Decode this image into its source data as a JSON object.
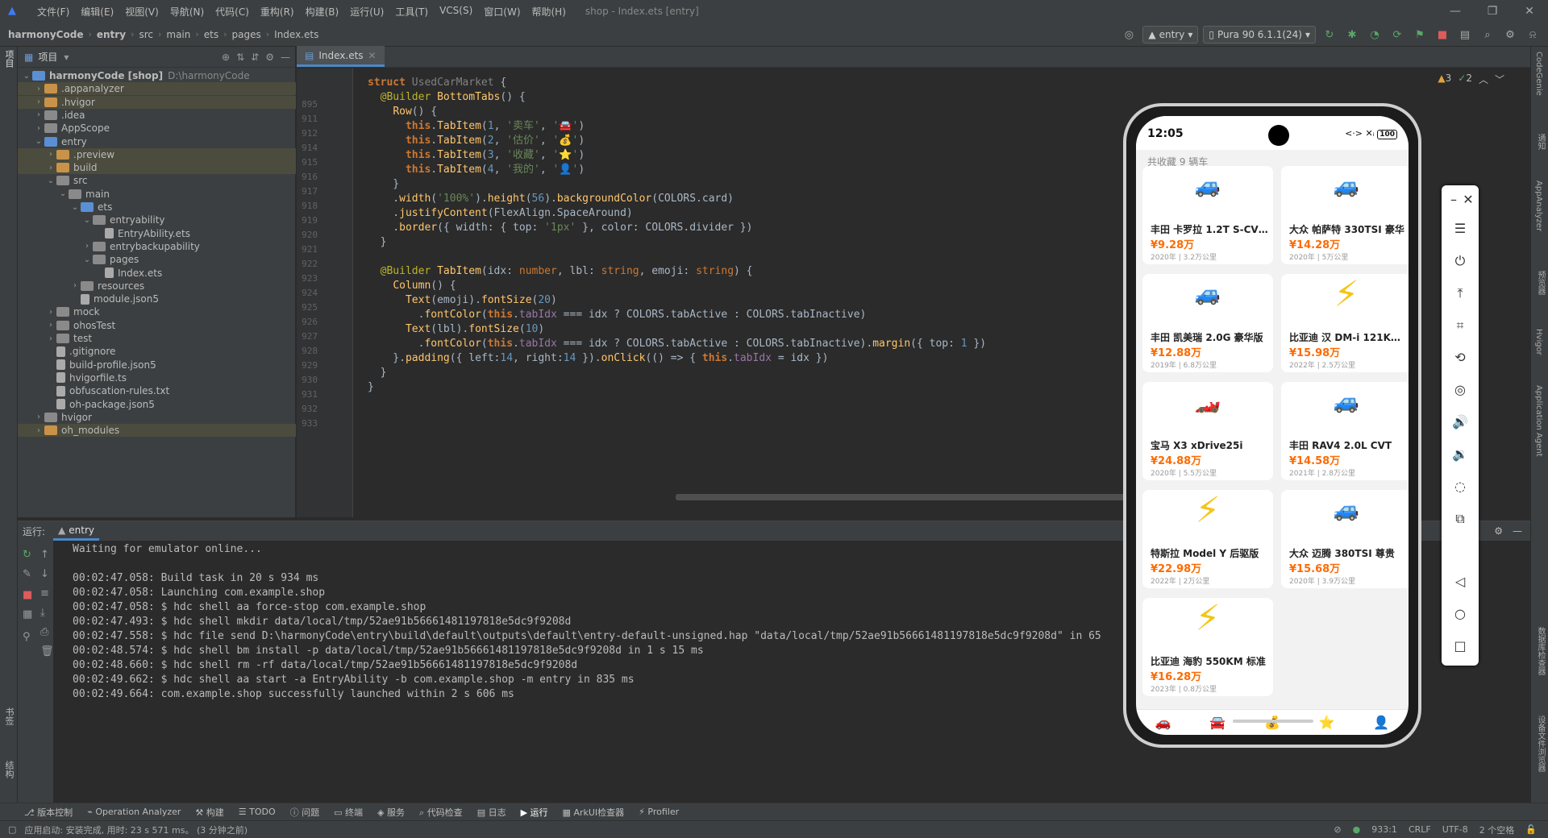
{
  "menu": {
    "items": [
      "文件(F)",
      "编辑(E)",
      "视图(V)",
      "导航(N)",
      "代码(C)",
      "重构(R)",
      "构建(B)",
      "运行(U)",
      "工具(T)",
      "VCS(S)",
      "窗口(W)",
      "帮助(H)"
    ],
    "window_title": "shop - Index.ets [entry]"
  },
  "breadcrumb": [
    "harmonyCode",
    "entry",
    "src",
    "main",
    "ets",
    "pages",
    "Index.ets"
  ],
  "toolbar": {
    "module": "entry",
    "device": "Pura 90 6.1.1(24)"
  },
  "project_panel": {
    "title": "项目",
    "tree": [
      {
        "label": "harmonyCode [shop]",
        "extra": "D:\\harmonyCode",
        "depth": 0,
        "open": true,
        "type": "folder-blue",
        "sel": false
      },
      {
        "label": ".appanalyzer",
        "depth": 1,
        "open": false,
        "type": "folder-orange",
        "sel": true
      },
      {
        "label": ".hvigor",
        "depth": 1,
        "open": false,
        "type": "folder-orange",
        "sel": true
      },
      {
        "label": ".idea",
        "depth": 1,
        "open": false,
        "type": "folder",
        "sel": false
      },
      {
        "label": "AppScope",
        "depth": 1,
        "open": false,
        "type": "folder",
        "sel": false
      },
      {
        "label": "entry",
        "depth": 1,
        "open": true,
        "type": "folder-blue",
        "sel": false
      },
      {
        "label": ".preview",
        "depth": 2,
        "open": false,
        "type": "folder-orange",
        "sel": true
      },
      {
        "label": "build",
        "depth": 2,
        "open": false,
        "type": "folder-orange",
        "sel": true
      },
      {
        "label": "src",
        "depth": 2,
        "open": true,
        "type": "folder",
        "sel": false
      },
      {
        "label": "main",
        "depth": 3,
        "open": true,
        "type": "folder",
        "sel": false
      },
      {
        "label": "ets",
        "depth": 4,
        "open": true,
        "type": "folder-blue",
        "sel": false
      },
      {
        "label": "entryability",
        "depth": 5,
        "open": true,
        "type": "folder",
        "sel": false
      },
      {
        "label": "EntryAbility.ets",
        "depth": 6,
        "open": null,
        "type": "file",
        "sel": false
      },
      {
        "label": "entrybackupability",
        "depth": 5,
        "open": false,
        "type": "folder",
        "sel": false
      },
      {
        "label": "pages",
        "depth": 5,
        "open": true,
        "type": "folder",
        "sel": false
      },
      {
        "label": "Index.ets",
        "depth": 6,
        "open": null,
        "type": "file",
        "sel": false
      },
      {
        "label": "resources",
        "depth": 4,
        "open": false,
        "type": "folder",
        "sel": false
      },
      {
        "label": "module.json5",
        "depth": 4,
        "open": null,
        "type": "file",
        "sel": false
      },
      {
        "label": "mock",
        "depth": 2,
        "open": false,
        "type": "folder",
        "sel": false
      },
      {
        "label": "ohosTest",
        "depth": 2,
        "open": false,
        "type": "folder",
        "sel": false
      },
      {
        "label": "test",
        "depth": 2,
        "open": false,
        "type": "folder",
        "sel": false
      },
      {
        "label": ".gitignore",
        "depth": 2,
        "open": null,
        "type": "file",
        "sel": false
      },
      {
        "label": "build-profile.json5",
        "depth": 2,
        "open": null,
        "type": "file",
        "sel": false
      },
      {
        "label": "hvigorfile.ts",
        "depth": 2,
        "open": null,
        "type": "file",
        "sel": false
      },
      {
        "label": "obfuscation-rules.txt",
        "depth": 2,
        "open": null,
        "type": "file",
        "sel": false
      },
      {
        "label": "oh-package.json5",
        "depth": 2,
        "open": null,
        "type": "file",
        "sel": false
      },
      {
        "label": "hvigor",
        "depth": 1,
        "open": false,
        "type": "folder",
        "sel": false
      },
      {
        "label": "oh_modules",
        "depth": 1,
        "open": false,
        "type": "folder-orange",
        "sel": true
      }
    ]
  },
  "editor": {
    "tab": "Index.ets",
    "warnings": "3",
    "weak_warnings": "2",
    "lines": [
      {
        "n": "895",
        "html": "<span class='kw'>struct</span> <span class='fn' style='color:#808080'>UsedCarMarket</span> {"
      },
      {
        "n": "911",
        "html": "  <span class='an'>@Builder</span> <span class='fn'>BottomTabs</span>() {"
      },
      {
        "n": "912",
        "html": "    <span class='fn'>Row</span>() {"
      },
      {
        "n": "914",
        "html": "      <span class='kw'>this</span>.<span class='fn'>TabItem</span>(<span class='num'>1</span>, <span class='str'>'卖车'</span>, <span class='str'>'🚘'</span>)"
      },
      {
        "n": "915",
        "html": "      <span class='kw'>this</span>.<span class='fn'>TabItem</span>(<span class='num'>2</span>, <span class='str'>'估价'</span>, <span class='str'>'💰'</span>)"
      },
      {
        "n": "916",
        "html": "      <span class='kw'>this</span>.<span class='fn'>TabItem</span>(<span class='num'>3</span>, <span class='str'>'收藏'</span>, <span class='str'>'⭐'</span>)"
      },
      {
        "n": "917",
        "html": "      <span class='kw'>this</span>.<span class='fn'>TabItem</span>(<span class='num'>4</span>, <span class='str'>'我的'</span>, <span class='str'>'👤'</span>)"
      },
      {
        "n": "918",
        "html": "    }"
      },
      {
        "n": "919",
        "html": "    .<span class='fn'>width</span>(<span class='str'>'100%'</span>).<span class='fn'>height</span>(<span class='num'>56</span>).<span class='fn'>backgroundColor</span>(COLORS.card)"
      },
      {
        "n": "920",
        "html": "    .<span class='fn'>justifyContent</span>(FlexAlign.SpaceAround)"
      },
      {
        "n": "921",
        "html": "    .<span class='fn'>border</span>({ width: { top: <span class='str'>'1px'</span> }, color: COLORS.divider })"
      },
      {
        "n": "922",
        "html": "  }"
      },
      {
        "n": "923",
        "html": ""
      },
      {
        "n": "924",
        "html": "  <span class='an'>@Builder</span> <span class='fn'>TabItem</span>(idx: <span class='ty'>number</span>, lbl: <span class='ty'>string</span>, emoji: <span class='ty'>string</span>) {"
      },
      {
        "n": "925",
        "html": "    <span class='fn'>Column</span>() {"
      },
      {
        "n": "926",
        "html": "      <span class='fn'>Text</span>(emoji).<span class='fn'>fontSize</span>(<span class='num'>20</span>)"
      },
      {
        "n": "927",
        "html": "        .<span class='fn'>fontColor</span>(<span class='kw'>this</span>.<span class='pur'>tabIdx</span> === idx ? COLORS.tabActive : COLORS.tabInactive)"
      },
      {
        "n": "928",
        "html": "      <span class='fn'>Text</span>(lbl).<span class='fn'>fontSize</span>(<span class='num'>10</span>)"
      },
      {
        "n": "929",
        "html": "        .<span class='fn'>fontColor</span>(<span class='kw'>this</span>.<span class='pur'>tabIdx</span> === idx ? COLORS.tabActive : COLORS.tabInactive).<span class='fn'>margin</span>({ top: <span class='num'>1</span> })"
      },
      {
        "n": "930",
        "html": "    }.<span class='fn'>padding</span>({ left:<span class='num'>14</span>, right:<span class='num'>14</span> }).<span class='fn'>onClick</span>(() => { <span class='kw'>this</span>.<span class='pur'>tabIdx</span> = idx })"
      },
      {
        "n": "931",
        "html": "  }"
      },
      {
        "n": "932",
        "html": "}"
      },
      {
        "n": "933",
        "html": ""
      }
    ]
  },
  "run_panel": {
    "label": "运行:",
    "tab": "entry",
    "log": [
      "Waiting for emulator online...",
      "",
      "00:02:47.058: Build task in 20 s 934 ms",
      "00:02:47.058: Launching com.example.shop",
      "00:02:47.058: $ hdc shell aa force-stop com.example.shop",
      "00:02:47.493: $ hdc shell mkdir data/local/tmp/52ae91b56661481197818e5dc9f9208d",
      "00:02:47.558: $ hdc file send D:\\harmonyCode\\entry\\build\\default\\outputs\\default\\entry-default-unsigned.hap \"data/local/tmp/52ae91b56661481197818e5dc9f9208d\" in 65",
      "00:02:48.574: $ hdc shell bm install -p data/local/tmp/52ae91b56661481197818e5dc9f9208d in 1 s 15 ms",
      "00:02:48.660: $ hdc shell rm -rf data/local/tmp/52ae91b56661481197818e5dc9f9208d",
      "00:02:49.662: $ hdc shell aa start -a EntryAbility -b com.example.shop -m entry in 835 ms",
      "00:02:49.664: com.example.shop successfully launched within 2 s 606 ms"
    ]
  },
  "bottom_tabs": [
    "版本控制",
    "Operation Analyzer",
    "构建",
    "TODO",
    "问题",
    "终端",
    "服务",
    "代码检查",
    "日志",
    "运行",
    "ArkUI检查器",
    "Profiler"
  ],
  "status": {
    "message": "应用启动: 安装完成, 用时: 23 s 571 ms。 (3 分钟之前)",
    "position": "933:1",
    "line_sep": "CRLF",
    "encoding": "UTF-8",
    "indent": "2 个空格"
  },
  "left_strip": [
    "项目",
    "书签",
    "结构"
  ],
  "right_strip": [
    "CodeGenie",
    "通知",
    "AppAnalyzer",
    "预览器",
    "Hvigor",
    "Application Agent",
    "数据库检查器",
    "设备文件浏览器"
  ],
  "phone": {
    "time": "12:05",
    "battery": "100",
    "count": "共收藏 9 辆车",
    "cars": [
      {
        "icon": "🚙",
        "name": "丰田 卡罗拉 1.2T S-CVT...",
        "price": "¥9.28万",
        "meta": "2020年 | 3.2万公里"
      },
      {
        "icon": "🚙",
        "name": "大众 帕萨特 330TSI 豪华",
        "price": "¥14.28万",
        "meta": "2020年 | 5万公里"
      },
      {
        "icon": "🚙",
        "name": "丰田 凯美瑞 2.0G 豪华版",
        "price": "¥12.88万",
        "meta": "2019年 | 6.8万公里"
      },
      {
        "icon": "⚡",
        "name": "比亚迪 汉 DM-i 121KM ...",
        "price": "¥15.98万",
        "meta": "2022年 | 2.5万公里"
      },
      {
        "icon": "🏎️",
        "name": "宝马 X3 xDrive25i",
        "price": "¥24.88万",
        "meta": "2020年 | 5.5万公里"
      },
      {
        "icon": "🚙",
        "name": "丰田 RAV4 2.0L CVT",
        "price": "¥14.58万",
        "meta": "2021年 | 2.8万公里"
      },
      {
        "icon": "⚡",
        "name": "特斯拉 Model Y 后驱版",
        "price": "¥22.98万",
        "meta": "2022年 | 2万公里"
      },
      {
        "icon": "🚙",
        "name": "大众 迈腾 380TSI 尊贵",
        "price": "¥15.68万",
        "meta": "2020年 | 3.9万公里"
      },
      {
        "icon": "⚡",
        "name": "比亚迪 海豹 550KM 标准",
        "price": "¥16.28万",
        "meta": "2023年 | 0.8万公里"
      }
    ],
    "tab_icons": [
      "🚗",
      "🚘",
      "💰",
      "⭐",
      "👤"
    ]
  },
  "emulator_controls": [
    "minimize-icon",
    "close-icon",
    "menu-icon",
    "power-icon",
    "top-icon",
    "crop-icon",
    "rotate-icon",
    "screenshot-icon",
    "volume-up-icon",
    "volume-down-icon",
    "shake-icon",
    "multi-screen-icon",
    "back-icon",
    "home-icon",
    "recent-icon"
  ],
  "colors": {
    "accent": "#4a88c7",
    "price": "#ff6a00",
    "ide_bg": "#2b2b2b",
    "panel_bg": "#3c3f41"
  }
}
